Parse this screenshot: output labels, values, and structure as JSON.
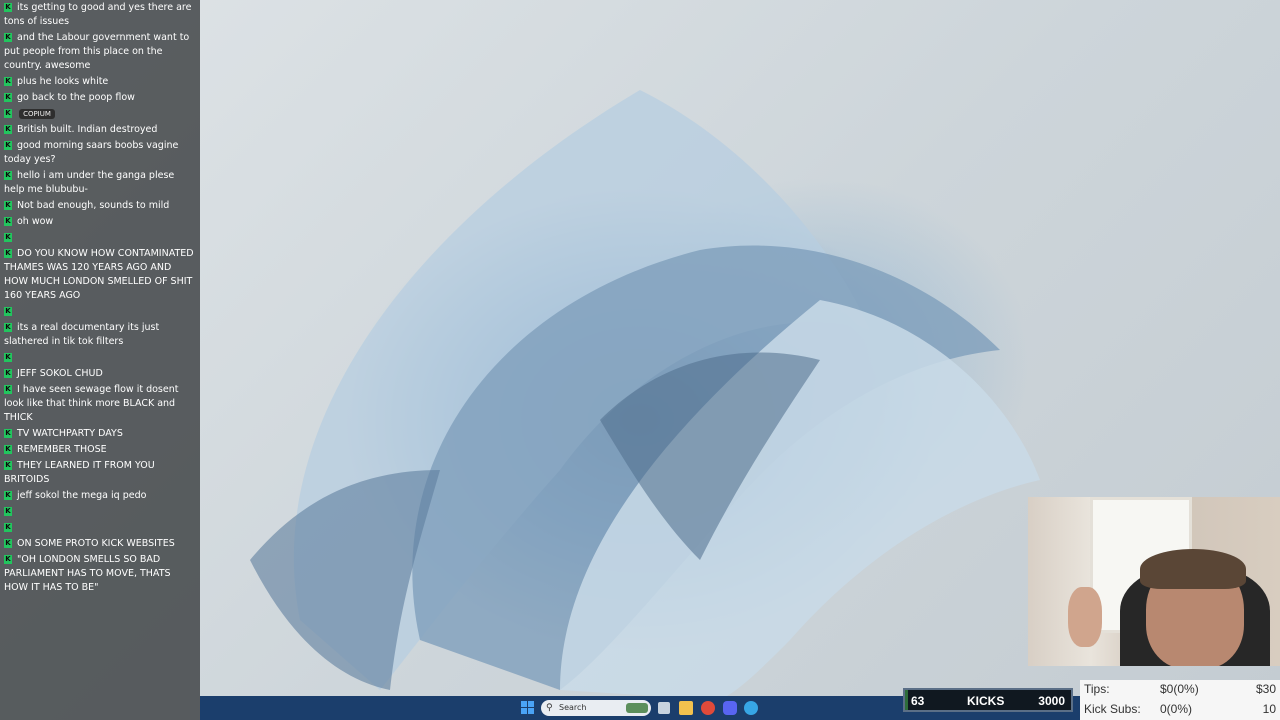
{
  "chat": {
    "messages": [
      {
        "user": "",
        "text": "its getting to good and yes there are tons of issues"
      },
      {
        "user": "",
        "text": "and the Labour government want to put people from this place on the country. awesome"
      },
      {
        "user": "",
        "text": "plus he looks white"
      },
      {
        "user": "",
        "text": "go back to the poop flow"
      },
      {
        "user": "",
        "text": "",
        "emote": "COPIUM"
      },
      {
        "user": "",
        "text": "British built. Indian destroyed"
      },
      {
        "user": "",
        "text": "good morning saars boobs vagine today yes?"
      },
      {
        "user": "",
        "text": "hello i am under the ganga plese help me blububu-"
      },
      {
        "user": "",
        "text": "Not bad enough, sounds to mild"
      },
      {
        "user": "",
        "text": "oh wow"
      },
      {
        "user": "",
        "text": ""
      },
      {
        "user": "",
        "text": "DO YOU KNOW HOW CONTAMINATED THAMES WAS 120 YEARS AGO AND HOW MUCH LONDON SMELLED OF SHIT 160 YEARS AGO"
      },
      {
        "user": "",
        "text": ""
      },
      {
        "user": "",
        "text": "its a real documentary its just slathered in tik tok filters"
      },
      {
        "user": "",
        "text": ""
      },
      {
        "user": "",
        "text": "JEFF SOKOL CHUD"
      },
      {
        "user": "",
        "text": "I have seen sewage flow it dosent look like that think more BLACK and THICK"
      },
      {
        "user": "",
        "text": "TV WATCHPARTY DAYS"
      },
      {
        "user": "",
        "text": "REMEMBER THOSE"
      },
      {
        "user": "",
        "text": "THEY LEARNED IT FROM YOU BRITOIDS"
      },
      {
        "user": "",
        "text": "jeff sokol the mega iq pedo"
      },
      {
        "user": "",
        "text": ""
      },
      {
        "user": "",
        "text": ""
      },
      {
        "user": "",
        "text": "ON SOME PROTO KICK WEBSITES"
      },
      {
        "user": "",
        "text": "\"OH LONDON SMELLS SO BAD PARLIAMENT HAS TO MOVE, THATS HOW IT HAS TO BE\""
      }
    ]
  },
  "taskbar": {
    "search_placeholder": "Search"
  },
  "kicks_bar": {
    "current": "63",
    "label": "KICKS",
    "goal": "3000",
    "progress_fraction": 0.021
  },
  "tips_panel": {
    "tips_label": "Tips:",
    "tips_value": "$0(0%)",
    "tips_goal": "$30",
    "subs_label": "Kick Subs:",
    "subs_value": "0(0%)",
    "subs_goal": "10"
  },
  "colors": {
    "kick_green": "#22c55e",
    "username_blue": "#6f7bd8",
    "taskbar_blue": "#1b3e6c"
  }
}
